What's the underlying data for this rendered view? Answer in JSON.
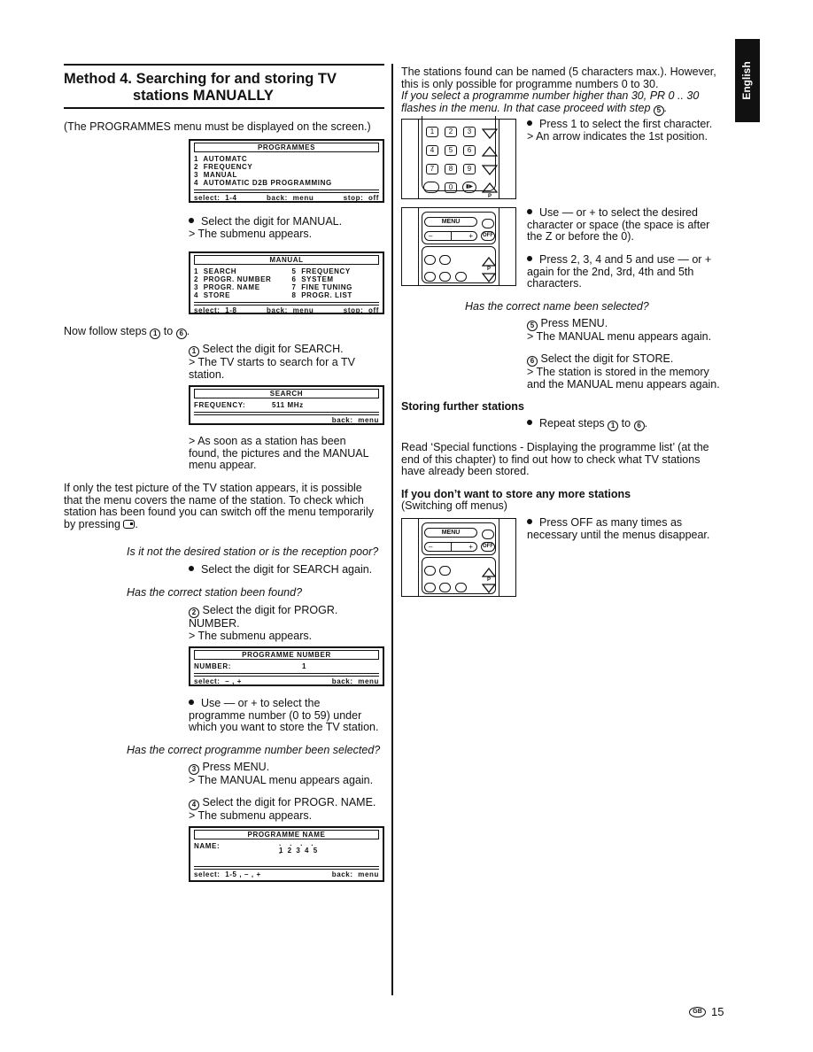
{
  "side_tab": {
    "language": "English"
  },
  "left": {
    "heading_line1": "Method 4. Searching for and storing TV",
    "heading_line2": "stations MANUALLY",
    "intro": "(The PROGRAMMES menu must be displayed on the screen.)",
    "menu_programmes": {
      "title": "PROGRAMMES",
      "items": [
        "1  AUTOMATC",
        "2  FREQUENCY",
        "3  MANUAL",
        "4  AUTOMATIC D2B PROGRAMMING"
      ],
      "footer": [
        "select:  1-4",
        "back:  menu",
        "stop:  off"
      ]
    },
    "select_manual": "Select the digit for MANUAL.",
    "submenu_appears": "> The submenu appears.",
    "menu_manual": {
      "title": "MANUAL",
      "items_left": [
        "1  SEARCH",
        "2  PROGR. NUMBER",
        "3  PROGR. NAME",
        "4  STORE"
      ],
      "items_right": [
        "5  FREQUENCY",
        "6  SYSTEM",
        "7  FINE TUNING",
        "8  PROGR. LIST"
      ],
      "footer": [
        "select:  1-8",
        "back:  menu",
        "stop:  off"
      ]
    },
    "follow_steps_pre": "Now follow steps",
    "follow_steps_mid": "to",
    "step1": {
      "num": "1",
      "text": "Select the digit for SEARCH.",
      "result1": "> The TV starts to search for a TV",
      "result2": "station."
    },
    "menu_search": {
      "title": "SEARCH",
      "label": "FREQUENCY:",
      "value": "511 MHz",
      "footer": [
        "back:  menu"
      ]
    },
    "found_1": "> As soon as a station has been",
    "found_2": "found, the pictures and the MANUAL",
    "found_3": "menu appear.",
    "testpic_1": "If only the test picture of the TV station appears, it is possible",
    "testpic_2": "that the menu covers the name of the station. To check which",
    "testpic_3": "station has been found you can switch off the menu temporarily",
    "testpic_4": "by pressing",
    "q_reception": "Is it not the desired station or is the reception poor?",
    "search_again": "Select the digit for SEARCH again.",
    "q_found": "Has the correct station been found?",
    "step2": {
      "num": "2",
      "text1": "Select the digit for PROGR.",
      "text2": "NUMBER.",
      "result": "> The submenu appears."
    },
    "menu_prognum": {
      "title": "PROGRAMME NUMBER",
      "label": "NUMBER:",
      "value": "1",
      "footer": [
        "select:  – , +",
        "back:  menu"
      ]
    },
    "use_pm_1": "Use — or + to select the",
    "use_pm_2": "programme number (0 to 59) under",
    "use_pm_3": "which you want to store the TV station.",
    "q_prognum": "Has the correct programme number been selected?",
    "step3": {
      "num": "3",
      "text": "Press MENU.",
      "result": "> The MANUAL menu appears again."
    },
    "step4": {
      "num": "4",
      "text": "Select the digit for PROGR. NAME.",
      "result": "> The submenu appears."
    },
    "menu_progname": {
      "title": "PROGRAMME NAME",
      "label": "NAME:",
      "positions": "1 2 3 4 5",
      "footer": [
        "select:  1-5 , – , +",
        "back:  menu"
      ]
    }
  },
  "right": {
    "intro_1": "The stations found can be named (5 characters max.). However,",
    "intro_2": "this is only possible for programme numbers 0 to 30.",
    "intro_3": "If you select a programme number higher than 30, PR 0 .. 30",
    "intro_4": "flashes in the menu. In that case proceed with step",
    "intro_step": "5",
    "remote_keypad": {
      "keys": [
        "1",
        "2",
        "3",
        "4",
        "5",
        "6",
        "7",
        "8",
        "9",
        "0"
      ]
    },
    "press1_a": "Press 1 to select the first character.",
    "press1_b": "> An arrow indicates the 1st position.",
    "remote_menu": {
      "menu_label": "MENU",
      "minus": "–",
      "plus": "+",
      "off": "OFF",
      "p": "P"
    },
    "use_char_1": "Use — or + to select the desired",
    "use_char_2": "character or space (the space is after",
    "use_char_3": "the Z or before the 0).",
    "press2345_1": "Press 2, 3, 4 and 5 and use — or +",
    "press2345_2": "again for the 2nd, 3rd, 4th and 5th",
    "press2345_3": "characters.",
    "q_name": "Has the correct name been selected?",
    "step5": {
      "num": "5",
      "text": "Press MENU.",
      "result": "> The MANUAL menu appears again."
    },
    "step6": {
      "num": "6",
      "text": "Select the digit for STORE.",
      "result1": "> The station is stored in the memory",
      "result2": "and the MANUAL menu appears again."
    },
    "further_heading": "Storing further stations",
    "repeat_pre": "Repeat steps",
    "repeat_mid": "to",
    "read_1": "Read ‘Special functions - Displaying the programme list’ (at the",
    "read_2": "end of this chapter) to find out how to check what TV stations",
    "read_3": "have already been stored.",
    "nomore_heading": "If you don’t want to store any more stations",
    "nomore_sub": "(Switching off menus)",
    "press_off_1": "Press OFF as many times as",
    "press_off_2": "necessary until the menus disappear."
  },
  "footer": {
    "country": "GB",
    "page": "15"
  }
}
